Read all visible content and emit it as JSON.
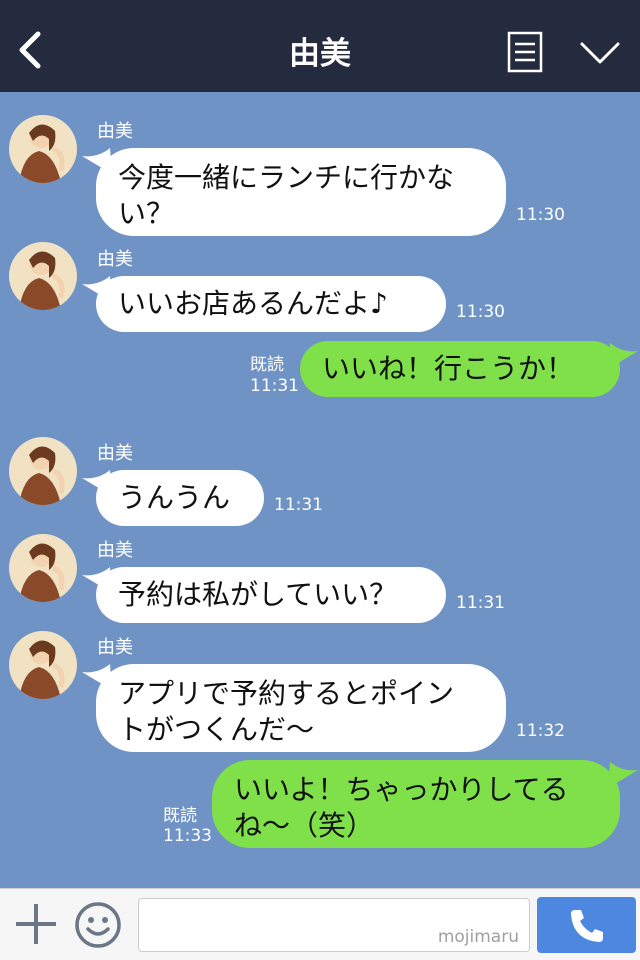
{
  "header": {
    "title": "由美",
    "back_icon": "chevron-left-icon",
    "menu_icon": "list-icon",
    "expand_icon": "chevron-down-icon"
  },
  "messages": [
    {
      "direction": "incoming",
      "sender": "由美",
      "text": "今度一緒にランチに行かな\nい？",
      "time": "11:30"
    },
    {
      "direction": "incoming",
      "sender": "由美",
      "text": "いいお店あるんだよ♪",
      "time": "11:30"
    },
    {
      "direction": "outgoing",
      "read": "既読",
      "text": "いいね！行こうか！",
      "time": "11:31"
    },
    {
      "direction": "incoming",
      "sender": "由美",
      "text": "うんうん",
      "time": "11:31"
    },
    {
      "direction": "incoming",
      "sender": "由美",
      "text": "予約は私がしていい？",
      "time": "11:31"
    },
    {
      "direction": "incoming",
      "sender": "由美",
      "text": "アプリで予約するとポイン\nトがつくんだ〜",
      "time": "11:32"
    },
    {
      "direction": "outgoing",
      "read": "既読",
      "text": "いいよ！ちゃっかりしてる\nね〜（笑）",
      "time": "11:33"
    }
  ],
  "composer": {
    "placeholder": "",
    "watermark": "mojimaru",
    "plus_icon": "plus-icon",
    "sticker_icon": "smile-icon",
    "call_icon": "phone-icon"
  },
  "colors": {
    "header_bg": "#242b3e",
    "chat_bg": "#7093c5",
    "incoming_bubble": "#ffffff",
    "outgoing_bubble": "#80e04a",
    "call_button": "#4d87e0"
  }
}
